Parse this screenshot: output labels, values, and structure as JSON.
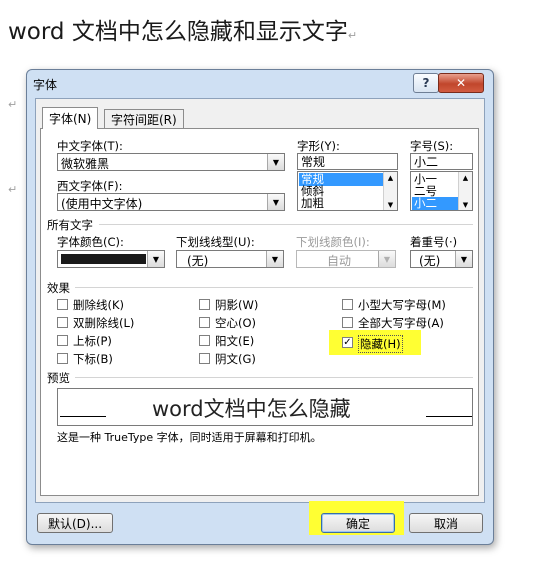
{
  "doc": {
    "title": "word 文档中怎么隐藏和显示文字",
    "para_mark": "↵"
  },
  "dialog": {
    "title": "字体",
    "help_label": "?",
    "close_label": "✕",
    "tabs": [
      {
        "label": "字体(N)",
        "active": true
      },
      {
        "label": "字符间距(R)",
        "active": false
      }
    ],
    "chinese_font": {
      "label": "中文字体(T):",
      "value": "微软雅黑"
    },
    "western_font": {
      "label": "西文字体(F):",
      "value": "(使用中文字体)"
    },
    "style": {
      "label": "字形(Y):",
      "value": "常规",
      "options": [
        "常规",
        "倾斜",
        "加粗"
      ],
      "selected": "常规"
    },
    "size": {
      "label": "字号(S):",
      "value": "小二",
      "options": [
        "小一",
        "二号",
        "小二"
      ],
      "selected": "小二"
    },
    "all_text_label": "所有文字",
    "font_color": {
      "label": "字体颜色(C):",
      "swatch": "#1a1a1a"
    },
    "underline_style": {
      "label": "下划线线型(U):",
      "value": "(无)"
    },
    "underline_color": {
      "label": "下划线颜色(I):",
      "value": "自动"
    },
    "emphasis": {
      "label": "着重号(·)",
      "value": "(无)"
    },
    "effects_label": "效果",
    "effects": {
      "strikethrough": {
        "label": "删除线(K)",
        "checked": false
      },
      "double_strikethrough": {
        "label": "双删除线(L)",
        "checked": false
      },
      "superscript": {
        "label": "上标(P)",
        "checked": false
      },
      "subscript": {
        "label": "下标(B)",
        "checked": false
      },
      "shadow": {
        "label": "阴影(W)",
        "checked": false
      },
      "outline": {
        "label": "空心(O)",
        "checked": false
      },
      "emboss": {
        "label": "阳文(E)",
        "checked": false
      },
      "engrave": {
        "label": "阴文(G)",
        "checked": false
      },
      "small_caps": {
        "label": "小型大写字母(M)",
        "checked": false
      },
      "all_caps": {
        "label": "全部大写字母(A)",
        "checked": false
      },
      "hidden": {
        "label": "隐藏(H)",
        "checked": true,
        "check_glyph": "✓"
      }
    },
    "preview_label": "预览",
    "preview_text": "word文档中怎么隐藏",
    "preview_note": "这是一种 TrueType 字体，同时适用于屏幕和打印机。",
    "default_button": "默认(D)...",
    "ok_button": "确定",
    "cancel_button": "取消",
    "highlight_color": "#ffff33"
  }
}
